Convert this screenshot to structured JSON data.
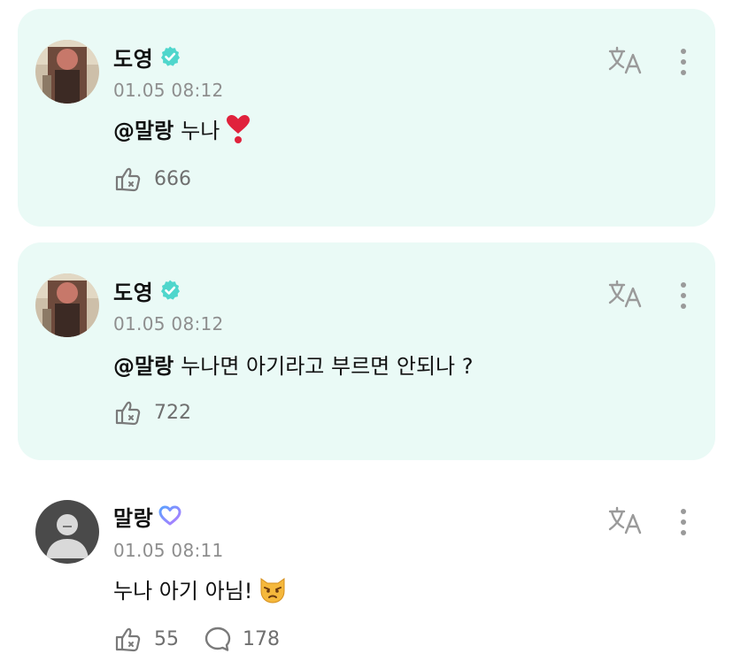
{
  "comments": [
    {
      "author": "도영",
      "verified": true,
      "timestamp": "01.05 08:12",
      "mention": "@말랑",
      "text": "누나",
      "emoji": "❣️",
      "likes": "666",
      "translate_icon": "translate-icon",
      "more_icon": "more-vertical-icon"
    },
    {
      "author": "도영",
      "verified": true,
      "timestamp": "01.05 08:12",
      "mention": "@말랑",
      "text": "누나면 아기라고 부르면 안되나 ?",
      "likes": "722",
      "translate_icon": "translate-icon",
      "more_icon": "more-vertical-icon"
    },
    {
      "author": "말랑",
      "badge": "heart-badge",
      "timestamp": "01.05 08:11",
      "text": "누나 아기 아님!",
      "emoji": "😾",
      "likes": "55",
      "replies": "178",
      "translate_icon": "translate-icon",
      "more_icon": "more-vertical-icon"
    }
  ],
  "colors": {
    "highlight_bg": "#eafaf6",
    "verified": "#4fd6cc",
    "heart_badge_start": "#5aa0ff",
    "heart_badge_end": "#b57bff",
    "muted_text": "#8e8e8e",
    "icon_gray": "#9a9a9a"
  }
}
